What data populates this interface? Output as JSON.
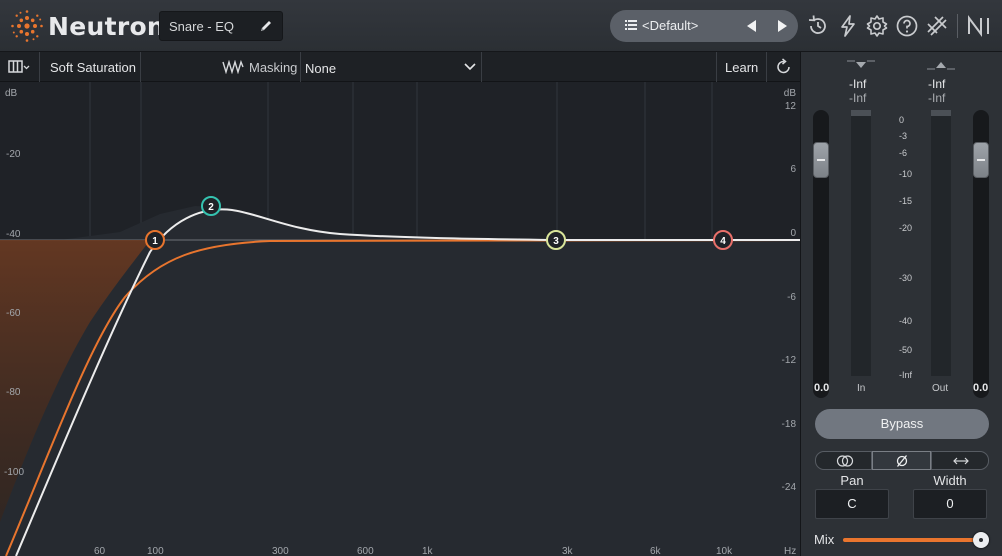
{
  "header": {
    "app_name": "Neutron",
    "module_preset": "Snare - EQ",
    "preset_selector": "<Default>"
  },
  "toolbar": {
    "saturation_label": "Soft Saturation",
    "masking_label": "Masking",
    "masking_value": "None",
    "learn_label": "Learn"
  },
  "eq": {
    "left_axis_unit": "dB",
    "right_axis_unit": "dB",
    "left_scale": [
      "-20",
      "-40",
      "-60",
      "-80",
      "-100"
    ],
    "right_scale": [
      "12",
      "6",
      "0",
      "-6",
      "-12",
      "-18",
      "-24"
    ],
    "freq_labels": [
      "60",
      "100",
      "300",
      "600",
      "1k",
      "3k",
      "6k",
      "10k",
      "Hz"
    ],
    "nodes": [
      {
        "id": "1",
        "color": "#e8752e"
      },
      {
        "id": "2",
        "color": "#35c3b0"
      },
      {
        "id": "3",
        "color": "#d9e59a"
      },
      {
        "id": "4",
        "color": "#e9706a"
      }
    ]
  },
  "meters": {
    "in_peak": "-Inf",
    "in_rms": "-Inf",
    "out_peak": "-Inf",
    "out_rms": "-Inf",
    "in_label": "In",
    "out_label": "Out",
    "in_gain": "0.0",
    "out_gain": "0.0",
    "scale": [
      "0",
      "-3",
      "-6",
      "-10",
      "-15",
      "-20",
      "-30",
      "-40",
      "-50",
      "-Inf"
    ]
  },
  "controls": {
    "bypass_label": "Bypass",
    "pan_label": "Pan",
    "pan_value": "C",
    "width_label": "Width",
    "width_value": "0",
    "mix_label": "Mix",
    "mix_level": 1.0
  },
  "colors": {
    "accent": "#e8752e",
    "curve": "#e6e6e6"
  }
}
